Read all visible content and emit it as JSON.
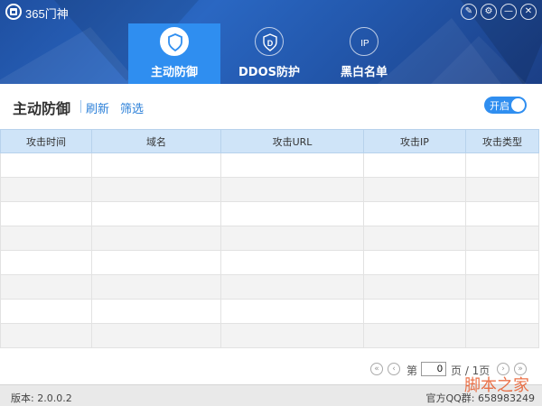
{
  "app": {
    "title": "365门神"
  },
  "window_controls": [
    {
      "name": "skin-icon",
      "glyph": "✎"
    },
    {
      "name": "settings-icon",
      "glyph": "⚙"
    },
    {
      "name": "minimize-icon",
      "glyph": "—"
    },
    {
      "name": "close-icon",
      "glyph": "✕"
    }
  ],
  "tabs": [
    {
      "label": "主动防御",
      "icon": "shield-icon",
      "active": true
    },
    {
      "label": "DDOS防护",
      "icon": "d-shield-icon",
      "active": false
    },
    {
      "label": "黑白名单",
      "icon": "ip-icon",
      "active": false
    }
  ],
  "content": {
    "title": "主动防御",
    "refresh_label": "刷新",
    "filter_label": "筛选",
    "toggle_label": "开启"
  },
  "table": {
    "columns": [
      "攻击时间",
      "域名",
      "攻击URL",
      "攻击IP",
      "攻击类型"
    ],
    "row_count": 8
  },
  "pager": {
    "prefix": "第",
    "current_page": "0",
    "suffix": "页 / 1页"
  },
  "status": {
    "version": "版本: 2.0.0.2",
    "qq_label": "官方QQ群: 658983249"
  },
  "watermark": "脚本之家",
  "colors": {
    "accent": "#2f8ef0",
    "header_dark": "#1f4fa0",
    "table_header": "#cfe4f8"
  }
}
